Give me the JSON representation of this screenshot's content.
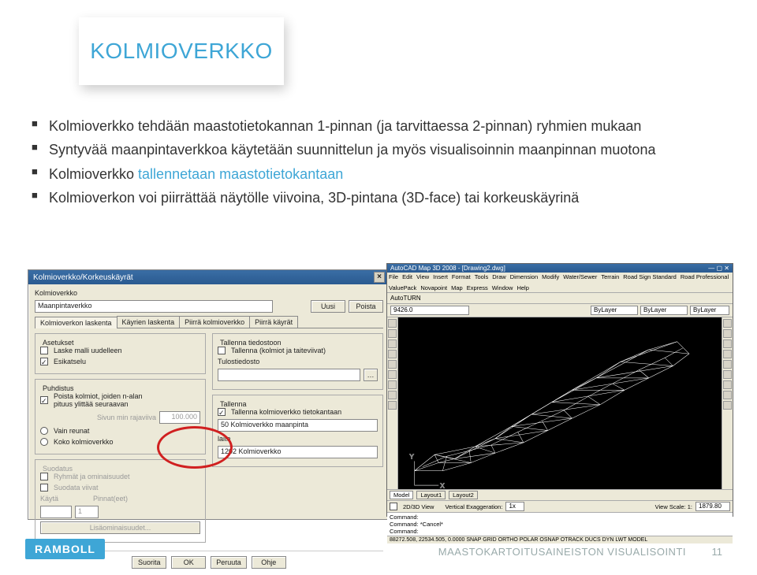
{
  "title": "KOLMIOVERKKO",
  "bullets": [
    {
      "text": "Kolmioverkko tehdään maastotietokannan 1-pinnan (ja tarvittaessa 2-pinnan) ryhmien mukaan"
    },
    {
      "text": "Syntyvää maanpintaverkkoa käytetään suunnittelun ja myös visualisoinnin maanpinnan muotona"
    },
    {
      "prefix": "Kolmioverkko ",
      "accent": "tallennetaan maastotietokantaan"
    },
    {
      "text": "Kolmioverkon voi piirrättää näytölle viivoina, 3D-pintana (3D-face) tai korkeuskäyrinä"
    }
  ],
  "dialog": {
    "title": "Kolmioverkko/Korkeuskäyrät",
    "label_kolmioverkko": "Kolmioverkko",
    "field_value": "Maanpintaverkko",
    "btn_uusi": "Uusi",
    "btn_poista": "Poista",
    "tabs": [
      "Kolmioverkon laskenta",
      "Käyrien laskenta",
      "Piirrä kolmioverkko",
      "Piirrä käyrät"
    ],
    "grp_asetukset": "Asetukset",
    "cb_laske": "Laske malli uudelleen",
    "cb_esikatselu": "Esikatselu",
    "grp_puhdistus": "Puhdistus",
    "cb_poista_kolmiot": "Poista kolmiot, joiden n-alan\npituus ylittää seuraavan",
    "num_field": "100.000",
    "rad_label": "Sivun min rajaviiva",
    "rad1": "Vain reunat",
    "rad2": "Koko kolmioverkko",
    "grp_suodatus": "Suodatus",
    "cb_ryhmat": "Ryhmät ja ominaisuudet",
    "cb_suodata": "Suodata viivat",
    "lbl_kayta": "Käytä",
    "lbl_pinnat": "Pinnat(eet)",
    "lbl_1": "1",
    "btn_lisaominaisuudet": "Lisäominaisuudet...",
    "grp_tallenna_tiedostoon": "Tallenna tiedostoon",
    "cb_tallenna_kolmiot": "Tallenna (kolmiot ja taiteviivat)",
    "lbl_tulostiedosto": "Tulostiedosto",
    "tulostiedosto_field": "",
    "grp_tallenna": "Tallenna",
    "cb_tallenna_db": "Tallenna kolmioverkko tietokantaan",
    "fld_50": "50 Kolmioverkko maanpinta",
    "lbl_laite": "laite",
    "fld_1202": "1202 Kolmioverkko",
    "btn_suorita": "Suorita",
    "btn_ok": "OK",
    "btn_peruuta": "Peruuta",
    "btn_ohje": "Ohje"
  },
  "acad": {
    "title": "AutoCAD Map 3D 2008 - [Drawing2.dwg]",
    "menu": [
      "File",
      "Edit",
      "View",
      "Insert",
      "Format",
      "Tools",
      "Draw",
      "Dimension",
      "Modify",
      "Water/Sewer",
      "Terrain",
      "Road Sign Standard",
      "Road Professional",
      "ValuePack",
      "Novapoint",
      "Map",
      "Express",
      "Window",
      "Help"
    ],
    "tool_left": "AutoTURN",
    "coord_field": "9426.0",
    "bylayer1": "ByLayer",
    "bylayer2": "ByLayer",
    "bylayer3": "ByLayer",
    "tab_model": "Model",
    "tab_layout1": "Layout1",
    "tab_layout2": "Layout2",
    "bottom_2d3d": "2D/3D View",
    "bottom_ve": "Vertical Exaggeration:",
    "bottom_ve_val": "1x",
    "bottom_vs": "View Scale: 1:",
    "bottom_vs_val": "1879.80",
    "cmd1": "Command:",
    "cmd2": "Command: *Cancel*",
    "cmd3": "Command:",
    "status": "88272.508, 22534.505, 0.0000  SNAP  GRID  ORTHO  POLAR  OSNAP  OTRACK  DUCS  DYN  LWT  MODEL"
  },
  "footer": {
    "logo": "RAMBOLL",
    "text": "MAASTOKARTOITUSAINEISTON VISUALISOINTI",
    "page": "11"
  }
}
